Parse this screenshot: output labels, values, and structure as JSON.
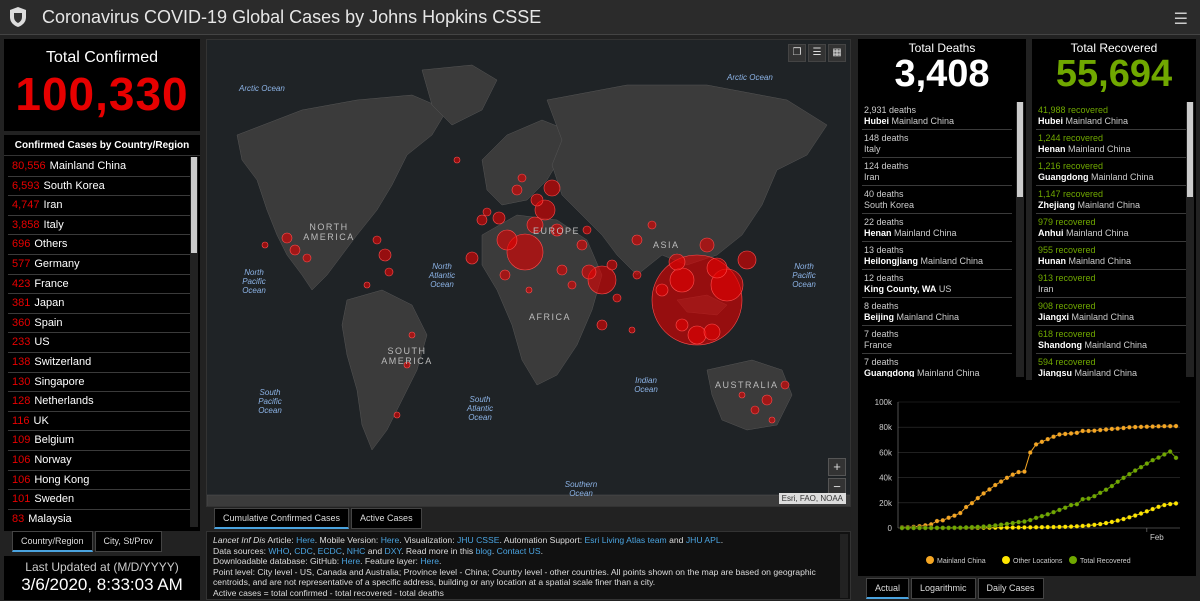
{
  "app": {
    "title": "Coronavirus COVID-19 Global Cases by Johns Hopkins CSSE",
    "menu_icon": "hamburger-icon"
  },
  "total_confirmed": {
    "label": "Total Confirmed",
    "value": "100,330"
  },
  "country_list": {
    "header": "Confirmed Cases by Country/Region",
    "rows": [
      {
        "num": "80,556",
        "name": "Mainland China"
      },
      {
        "num": "6,593",
        "name": "South Korea"
      },
      {
        "num": "4,747",
        "name": "Iran"
      },
      {
        "num": "3,858",
        "name": "Italy"
      },
      {
        "num": "696",
        "name": "Others"
      },
      {
        "num": "577",
        "name": "Germany"
      },
      {
        "num": "423",
        "name": "France"
      },
      {
        "num": "381",
        "name": "Japan"
      },
      {
        "num": "360",
        "name": "Spain"
      },
      {
        "num": "233",
        "name": "US"
      },
      {
        "num": "138",
        "name": "Switzerland"
      },
      {
        "num": "130",
        "name": "Singapore"
      },
      {
        "num": "128",
        "name": "Netherlands"
      },
      {
        "num": "116",
        "name": "UK"
      },
      {
        "num": "109",
        "name": "Belgium"
      },
      {
        "num": "106",
        "name": "Norway"
      },
      {
        "num": "106",
        "name": "Hong Kong"
      },
      {
        "num": "101",
        "name": "Sweden"
      },
      {
        "num": "83",
        "name": "Malaysia"
      }
    ]
  },
  "left_tabs": [
    "Country/Region",
    "City, St/Prov"
  ],
  "last_updated": {
    "label": "Last Updated at (M/D/YYYY)",
    "value": "3/6/2020, 8:33:03 AM"
  },
  "map": {
    "ocean_labels": [
      "Arctic Ocean",
      "Arctic Ocean",
      "North Pacific Ocean",
      "North Atlantic Ocean",
      "North Pacific Ocean",
      "South Pacific Ocean",
      "South Atlantic Ocean",
      "Indian Ocean",
      "Southern Ocean"
    ],
    "land_labels": [
      "NORTH AMERICA",
      "EUROPE",
      "ASIA",
      "AFRICA",
      "SOUTH AMERICA",
      "AUSTRALIA"
    ],
    "attribution": "Esri, FAO, NOAA",
    "zoom_in": "+",
    "zoom_out": "−"
  },
  "map_tabs": [
    "Cumulative Confirmed Cases",
    "Active Cases"
  ],
  "info": {
    "l1a": "Lancet Inf Dis",
    "l1b": " Article: ",
    "here1": "Here",
    "l1c": ". Mobile Version: ",
    "here2": "Here",
    "l1d": ". Visualization: ",
    "jhu": "JHU CSSE",
    "l1e": ". Automation Support: ",
    "esri": "Esri Living Atlas team",
    "l1f": " and ",
    "apl": "JHU APL",
    "l1g": ".",
    "l2a": "Data sources: ",
    "who": "WHO",
    "cdc": "CDC",
    "ecdc": "ECDC",
    "nhc": "NHC",
    "dxy": "DXY",
    "l2b": ". Read more in this ",
    "blog": "blog",
    "contact": "Contact US",
    "l3a": "Downloadable database: GitHub: ",
    "here3": "Here",
    "l3b": ". Feature layer: ",
    "here4": "Here",
    "l4": "Point level: City level - US, Canada and Australia; Province level - China; Country level - other countries. All points shown on the map are based on geographic centroids, and are not representative of a specific address, building or any location at a spatial scale finer than a city.",
    "l5": "Active cases = total confirmed - total recovered - total deaths"
  },
  "deaths": {
    "label": "Total Deaths",
    "value": "3,408",
    "rows": [
      {
        "count": "2,931 deaths",
        "bold": "Hubei",
        "rest": " Mainland China"
      },
      {
        "count": "148 deaths",
        "bold": "",
        "rest": "Italy"
      },
      {
        "count": "124 deaths",
        "bold": "",
        "rest": "Iran"
      },
      {
        "count": "40 deaths",
        "bold": "",
        "rest": "South Korea"
      },
      {
        "count": "22 deaths",
        "bold": "Henan",
        "rest": " Mainland China"
      },
      {
        "count": "13 deaths",
        "bold": "Heilongjiang",
        "rest": " Mainland China"
      },
      {
        "count": "12 deaths",
        "bold": "King County, WA",
        "rest": " US"
      },
      {
        "count": "8 deaths",
        "bold": "Beijing",
        "rest": " Mainland China"
      },
      {
        "count": "7 deaths",
        "bold": "",
        "rest": "France"
      },
      {
        "count": "7 deaths",
        "bold": "Guangdong",
        "rest": " Mainland China"
      }
    ]
  },
  "recovered": {
    "label": "Total Recovered",
    "value": "55,694",
    "rows": [
      {
        "count": "41,988 recovered",
        "bold": "Hubei",
        "rest": " Mainland China"
      },
      {
        "count": "1,244 recovered",
        "bold": "Henan",
        "rest": " Mainland China"
      },
      {
        "count": "1,216 recovered",
        "bold": "Guangdong",
        "rest": " Mainland China"
      },
      {
        "count": "1,147 recovered",
        "bold": "Zhejiang",
        "rest": " Mainland China"
      },
      {
        "count": "979 recovered",
        "bold": "Anhui",
        "rest": " Mainland China"
      },
      {
        "count": "955 recovered",
        "bold": "Hunan",
        "rest": " Mainland China"
      },
      {
        "count": "913 recovered",
        "bold": "",
        "rest": "Iran"
      },
      {
        "count": "908 recovered",
        "bold": "Jiangxi",
        "rest": " Mainland China"
      },
      {
        "count": "618 recovered",
        "bold": "Shandong",
        "rest": " Mainland China"
      },
      {
        "count": "594 recovered",
        "bold": "Jiangsu",
        "rest": " Mainland China"
      }
    ]
  },
  "chart_tabs": [
    "Actual",
    "Logarithmic",
    "Daily Cases"
  ],
  "colors": {
    "confirmed": "#e60000",
    "recovered": "#70a800",
    "mainland": "#f5a623",
    "other": "#ffe600"
  },
  "chart_data": {
    "type": "line",
    "xlabel": "",
    "ylabel": "",
    "x_tick_labels": [
      "Feb"
    ],
    "y_tick_labels": [
      "0",
      "20k",
      "40k",
      "60k",
      "80k",
      "100k"
    ],
    "ylim": [
      0,
      100000
    ],
    "legend_placement": "bottom",
    "series": [
      {
        "name": "Mainland China",
        "color": "#f5a623",
        "values": [
          548,
          643,
          920,
          1406,
          2075,
          2877,
          5509,
          6087,
          8141,
          9802,
          11891,
          16630,
          19716,
          23707,
          27440,
          30587,
          34110,
          36814,
          39829,
          42354,
          44386,
          44759,
          59895,
          66358,
          68413,
          70513,
          72434,
          74211,
          74619,
          75077,
          75550,
          77001,
          77022,
          77241,
          77754,
          78166,
          78600,
          78928,
          79356,
          79932,
          80136,
          80261,
          80386,
          80537,
          80690,
          80770,
          80823,
          80860
        ]
      },
      {
        "name": "Other Locations",
        "color": "#ffe600",
        "values": [
          7,
          10,
          15,
          20,
          27,
          35,
          45,
          55,
          70,
          85,
          100,
          120,
          150,
          180,
          200,
          230,
          260,
          290,
          320,
          360,
          400,
          450,
          500,
          560,
          620,
          690,
          760,
          850,
          950,
          1100,
          1300,
          1600,
          2000,
          2500,
          3100,
          3900,
          4800,
          5900,
          7100,
          8500,
          9900,
          11500,
          13200,
          15000,
          16800,
          18200,
          19000,
          19500
        ]
      },
      {
        "name": "Total Recovered",
        "color": "#70a800",
        "values": [
          28,
          30,
          36,
          39,
          52,
          61,
          107,
          126,
          143,
          222,
          284,
          472,
          623,
          852,
          1124,
          1487,
          2011,
          2616,
          3244,
          3946,
          4683,
          5150,
          6295,
          8058,
          9395,
          10865,
          12583,
          14352,
          16121,
          18177,
          18890,
          22886,
          23394,
          25227,
          27905,
          30384,
          33277,
          36711,
          39782,
          42716,
          45602,
          48228,
          51170,
          53796,
          55865,
          58358,
          60694,
          55694
        ]
      }
    ]
  }
}
